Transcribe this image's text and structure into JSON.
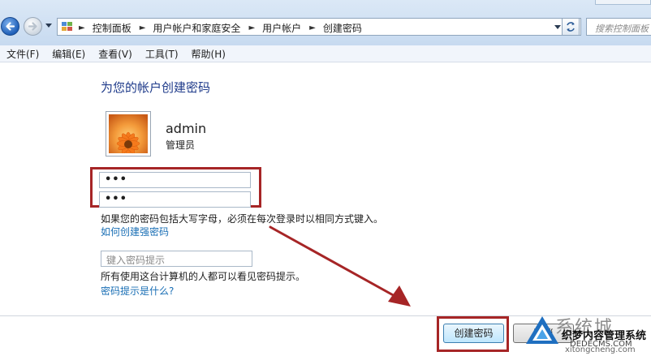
{
  "breadcrumbs": [
    "控制面板",
    "用户帐户和家庭安全",
    "用户帐户",
    "创建密码"
  ],
  "search": {
    "placeholder": "搜索控制面板"
  },
  "menu": [
    "文件(F)",
    "编辑(E)",
    "查看(V)",
    "工具(T)",
    "帮助(H)"
  ],
  "page": {
    "title": "为您的帐户创建密码",
    "user": {
      "name": "admin",
      "role": "管理员"
    },
    "password": {
      "value": "•••"
    },
    "confirm_password": {
      "value": "•••"
    },
    "case_note": "如果您的密码包括大写字母，必须在每次登录时以相同方式键入。",
    "strong_link": "如何创建强密码",
    "hint": {
      "placeholder": "键入密码提示"
    },
    "hint_note": "所有使用这台计算机的人都可以看见密码提示。",
    "hint_link": "密码提示是什么?"
  },
  "buttons": {
    "create": "创建密码",
    "cancel": "取消"
  },
  "watermark": {
    "logo_text": "系统城",
    "line1": "织梦内容管理系统",
    "line2": "DEDECMS.COM",
    "line3": "xitongcheng.com"
  },
  "colors": {
    "highlight": "#a62526",
    "link": "#1a6fb5",
    "heading": "#1e3a8a"
  },
  "icons": [
    "back-icon",
    "forward-icon",
    "control-panel-icon",
    "refresh-icon",
    "user-avatar-flower"
  ]
}
